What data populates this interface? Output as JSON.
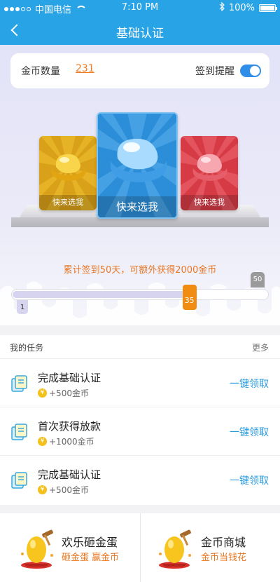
{
  "status_bar": {
    "carrier": "中国电信",
    "time": "7:10 PM",
    "battery": "100%"
  },
  "nav": {
    "title": "基础认证",
    "back_icon": "chevron-left-icon"
  },
  "coins": {
    "label": "金币数量",
    "value": "231",
    "remind_label": "签到提醒",
    "remind_on": true
  },
  "prizes": [
    {
      "caption": "快来选我",
      "color": "#d9a019"
    },
    {
      "caption": "快来选我",
      "color": "#2c8ed8"
    },
    {
      "caption": "快来选我",
      "color": "#d63b45"
    }
  ],
  "progress": {
    "bonus_text": "累计签到50天，可额外获得2000金币",
    "start": "1",
    "current": "35",
    "max": "50"
  },
  "tasks": {
    "title": "我的任务",
    "more": "更多",
    "items": [
      {
        "name": "完成基础认证",
        "reward": "+500金币",
        "action": "一键领取"
      },
      {
        "name": "首次获得放款",
        "reward": "+1000金币",
        "action": "一键领取"
      },
      {
        "name": "完成基础认证",
        "reward": "+500金币",
        "action": "一键领取"
      }
    ]
  },
  "promos": [
    {
      "title": "欢乐砸金蛋",
      "subtitle": "砸金蛋 赢金币"
    },
    {
      "title": "金币商城",
      "subtitle": "金币当钱花"
    }
  ],
  "colors": {
    "brand_blue": "#28a3e6",
    "accent_orange": "#f08c12",
    "link_blue": "#2a9be0"
  }
}
